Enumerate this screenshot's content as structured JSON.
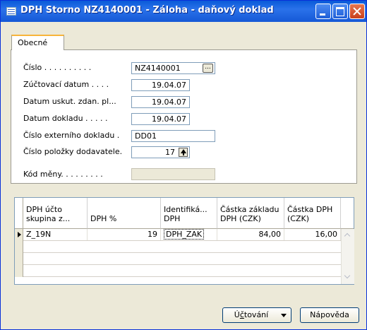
{
  "window": {
    "title": "DPH Storno NZ4140001 - Záloha - daňový doklad"
  },
  "tabs": [
    {
      "label": "Obecné"
    }
  ],
  "form": {
    "cislo_label": "Číslo . . . . . . . . . .",
    "cislo_value": "NZ4140001",
    "zuctovaci_label": "Zúčtovací datum  . . . .",
    "zuctovaci_value": "19.04.07",
    "datum_uskut_label": "Datum uskut. zdan. pl...",
    "datum_uskut_value": "19.04.07",
    "datum_dokladu_label": "Datum dokladu  . . . . .",
    "datum_dokladu_value": "19.04.07",
    "externi_label": "Číslo externího dokladu  .",
    "externi_value": "DD01",
    "polozky_label": "Číslo položky dodavatele.",
    "polozky_value": "17",
    "mena_label": "Kód měny. . . . . . . . .",
    "mena_value": ""
  },
  "table": {
    "headers": [
      "DPH účto\nskupina z...",
      "DPH %",
      "Identifiká...\nDPH",
      "Částka základu\nDPH (CZK)",
      "Částka DPH\n(CZK)"
    ],
    "rows": [
      {
        "skupina": "Z_19N",
        "procento": "19",
        "identifikace": "DPH_ZAK",
        "zaklad": "84,00",
        "castka": "16,00"
      }
    ]
  },
  "buttons": {
    "uctovani_prefix": "Ú",
    "uctovani_underline": "č",
    "uctovani_rest": "tování",
    "napoveda_label": "Nápověda"
  }
}
